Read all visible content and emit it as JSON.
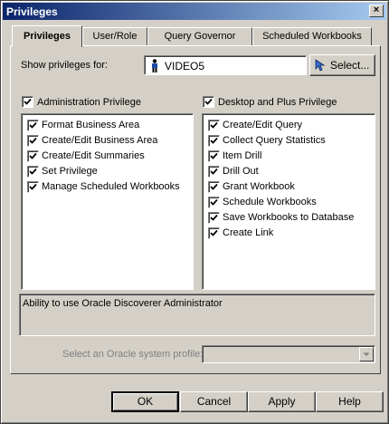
{
  "window": {
    "title": "Privileges",
    "close_label": "×"
  },
  "tabs": [
    {
      "label": "Privileges"
    },
    {
      "label": "User/Role"
    },
    {
      "label": "Query Governor"
    },
    {
      "label": "Scheduled Workbooks"
    }
  ],
  "show_for": {
    "label": "Show privileges for:",
    "value": "VIDEO5",
    "select_button": "Select..."
  },
  "admin": {
    "header": "Administration Privilege",
    "checked": true,
    "items": [
      {
        "label": "Format Business Area",
        "checked": true
      },
      {
        "label": "Create/Edit Business Area",
        "checked": true
      },
      {
        "label": "Create/Edit Summaries",
        "checked": true
      },
      {
        "label": "Set Privilege",
        "checked": true
      },
      {
        "label": "Manage Scheduled Workbooks",
        "checked": true
      }
    ]
  },
  "desktop": {
    "header": "Desktop and Plus Privilege",
    "checked": true,
    "items": [
      {
        "label": "Create/Edit Query",
        "checked": true
      },
      {
        "label": "Collect Query Statistics",
        "checked": true
      },
      {
        "label": "Item Drill",
        "checked": true
      },
      {
        "label": "Drill Out",
        "checked": true
      },
      {
        "label": "Grant Workbook",
        "checked": true
      },
      {
        "label": "Schedule Workbooks",
        "checked": true
      },
      {
        "label": "Save Workbooks to Database",
        "checked": true
      },
      {
        "label": "Create Link",
        "checked": true
      }
    ]
  },
  "description": "Ability to use Oracle Discoverer Administrator",
  "system_profile": {
    "label": "Select an Oracle system profile:",
    "value": ""
  },
  "buttons": {
    "ok": "OK",
    "cancel": "Cancel",
    "apply": "Apply",
    "help": "Help"
  }
}
